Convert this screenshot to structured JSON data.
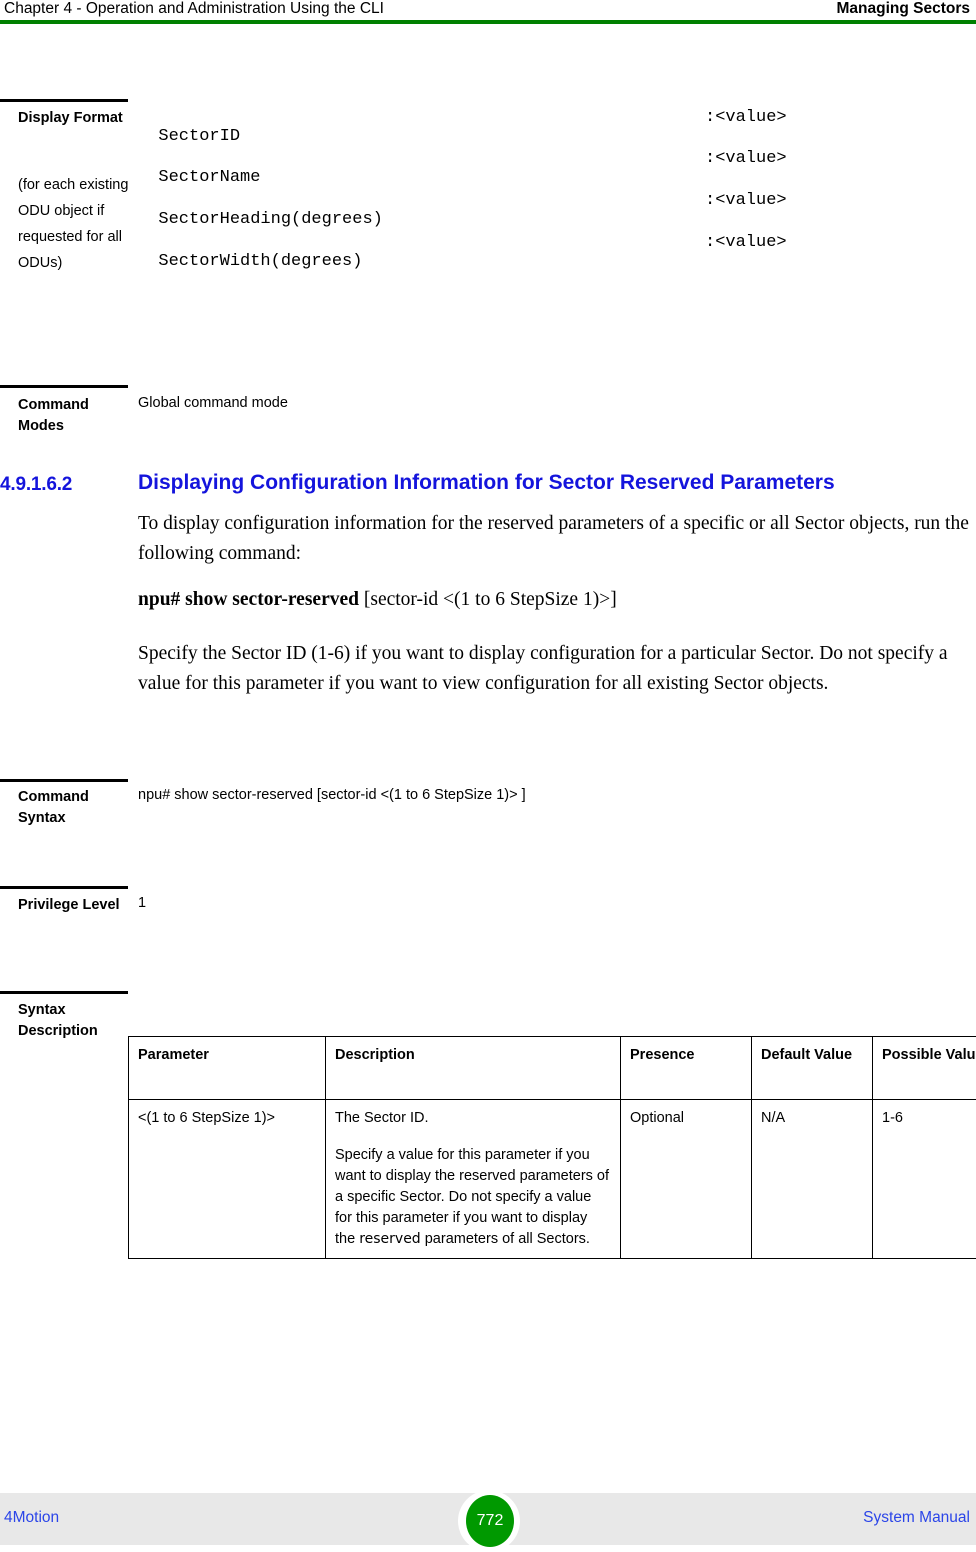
{
  "header": {
    "left": "Chapter 4 - Operation and Administration Using the CLI",
    "right": "Managing Sectors"
  },
  "display_format": {
    "label": "Display Format",
    "note": "(for each existing ODU object if requested for all ODUs)",
    "rows": [
      {
        "key": "SectorID",
        "value": ":<value>"
      },
      {
        "key": "SectorName",
        "value": ":<value>"
      },
      {
        "key": "SectorHeading(degrees)",
        "value": ":<value>"
      },
      {
        "key": "SectorWidth(degrees)",
        "value": ":<value>"
      }
    ]
  },
  "command_modes": {
    "label": "Command Modes",
    "value": "Global command mode"
  },
  "section": {
    "number": "4.9.1.6.2",
    "title": "Displaying Configuration Information for Sector Reserved Parameters",
    "paragraph1": "To display configuration information for the reserved parameters of a specific or all Sector objects, run the following command:",
    "command_bold": "npu# show sector-reserved",
    "command_rest": " [sector-id <(1 to 6 StepSize 1)>]",
    "paragraph2": "Specify the Sector ID (1-6) if you want to display configuration for a particular Sector. Do not specify a value for this parameter if you want to view configuration for all existing Sector objects."
  },
  "command_syntax": {
    "label": "Command Syntax",
    "value": "npu# show sector-reserved [sector-id <(1 to 6 StepSize 1)> ]"
  },
  "privilege_level": {
    "label": "Privilege Level",
    "value": "1"
  },
  "syntax_description": {
    "label": "Syntax Description",
    "columns": [
      "Parameter",
      "Description",
      "Presence",
      "Default Value",
      "Possible Values"
    ],
    "rows": [
      {
        "parameter": "<(1 to 6 StepSize 1)>",
        "description_1": "The Sector ID.",
        "description_2a": "Specify a value for this parameter if you want to display the reserved parameters of a specific Sector. Do not specify a value for this parameter if you want to display the ",
        "description_2b": "reserved",
        "description_2c": " parameters of all Sectors.",
        "presence": "Optional",
        "default_value": "N/A",
        "possible_values": "1-6"
      }
    ]
  },
  "footer": {
    "left": "4Motion",
    "page": "772",
    "right": "System Manual"
  },
  "colors": {
    "header_rule": "#008000",
    "heading": "#1414dc",
    "footer_text": "#2b45e8",
    "page_badge": "#009900",
    "footer_band": "#e8e8e8"
  }
}
